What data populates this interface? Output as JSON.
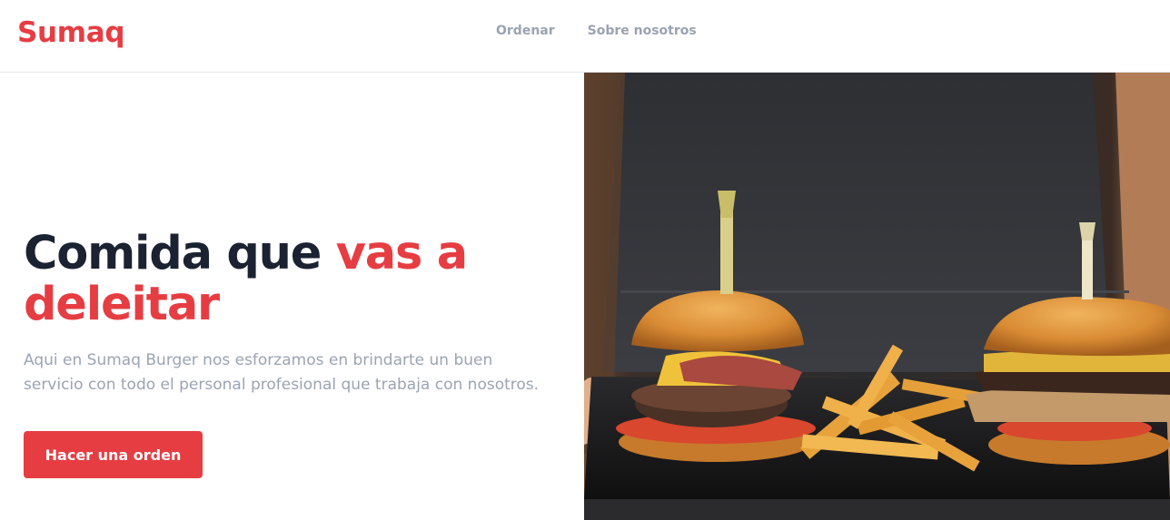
{
  "brand": {
    "name": "Sumaq",
    "color": "#e63d43"
  },
  "nav": {
    "items": [
      {
        "label": "Ordenar"
      },
      {
        "label": "Sobre nosotros"
      }
    ]
  },
  "hero": {
    "title_part1": "Comida que ",
    "title_accent_1": "vas a",
    "title_accent_2": "deleitar",
    "description": "Aqui en Sumaq Burger nos esforzamos en brindarte un buen servicio con todo el personal profesional que trabaja con nosotros.",
    "cta_label": "Hacer una orden",
    "image_alt": "Burgers and fries on a tray"
  },
  "colors": {
    "accent": "#e63d43",
    "heading": "#1b2231",
    "muted": "#9ba4b4",
    "nav": "#9aa3b2"
  }
}
